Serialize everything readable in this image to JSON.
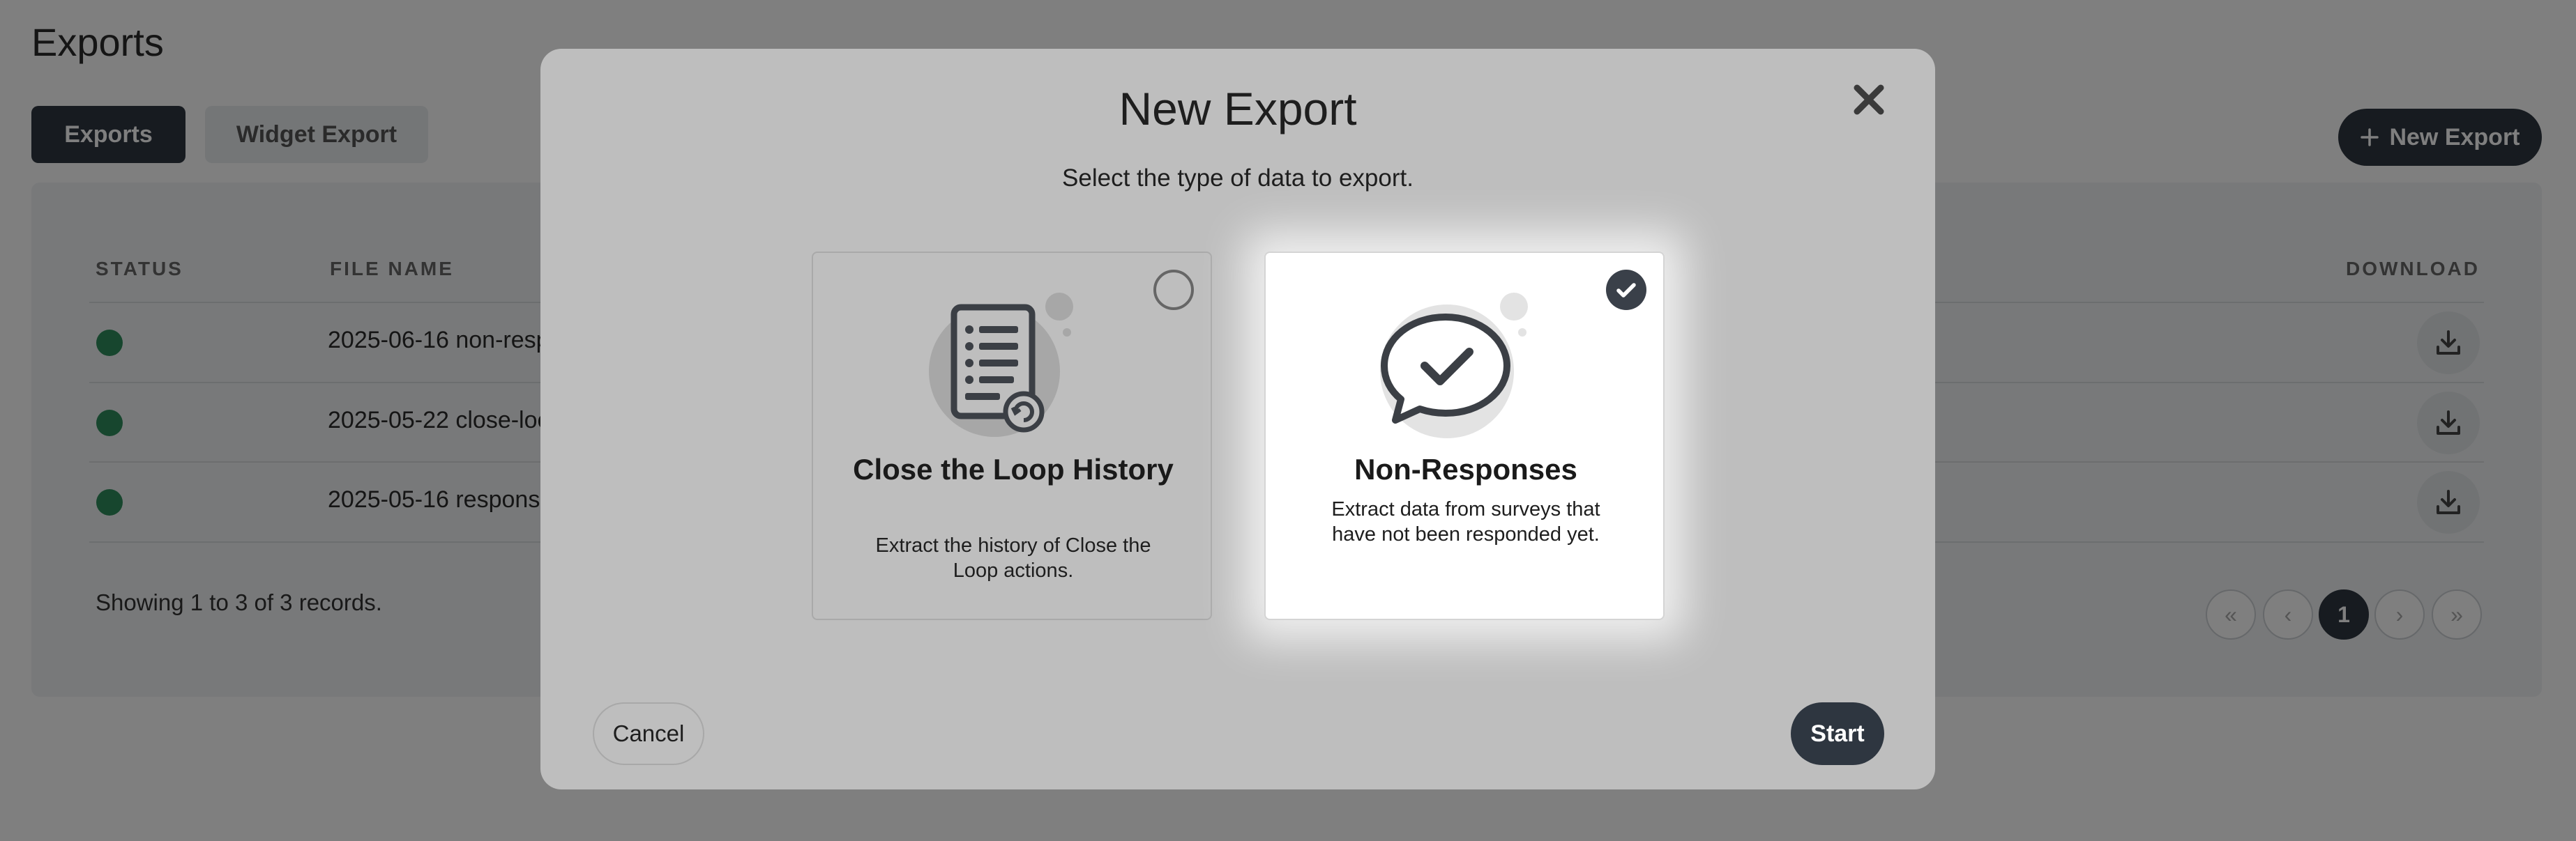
{
  "page": {
    "title": "Exports",
    "tabs": [
      {
        "label": "Exports",
        "active": true
      },
      {
        "label": "Widget Export",
        "active": false
      }
    ],
    "new_export_button": "New Export"
  },
  "table": {
    "columns": {
      "status": "STATUS",
      "file_name": "FILE NAME",
      "download": "DOWNLOAD"
    },
    "rows": [
      {
        "status": "complete",
        "file_name": "2025-06-16 non-resp"
      },
      {
        "status": "complete",
        "file_name": "2025-05-22 close-loo"
      },
      {
        "status": "complete",
        "file_name": "2025-05-16 respons"
      }
    ],
    "records_text": "Showing 1 to 3 of 3 records.",
    "pagination": {
      "first": "«",
      "prev": "‹",
      "current": "1",
      "next": "›",
      "last": "»"
    }
  },
  "modal": {
    "title": "New Export",
    "subtitle": "Select the type of data to export.",
    "options": [
      {
        "title": "Close the Loop History",
        "description": "Extract the history of Close the Loop actions.",
        "selected": false,
        "icon": "document-icon"
      },
      {
        "title": "Non-Responses",
        "description": "Extract data from surveys that have not been responded yet.",
        "selected": true,
        "icon": "speech-bubble-check-icon"
      }
    ],
    "cancel_label": "Cancel",
    "start_label": "Start"
  },
  "colors": {
    "primary_dark": "#2e3640",
    "status_green": "#2f8d5d",
    "overlay": "rgba(0,0,0,0.5)"
  }
}
